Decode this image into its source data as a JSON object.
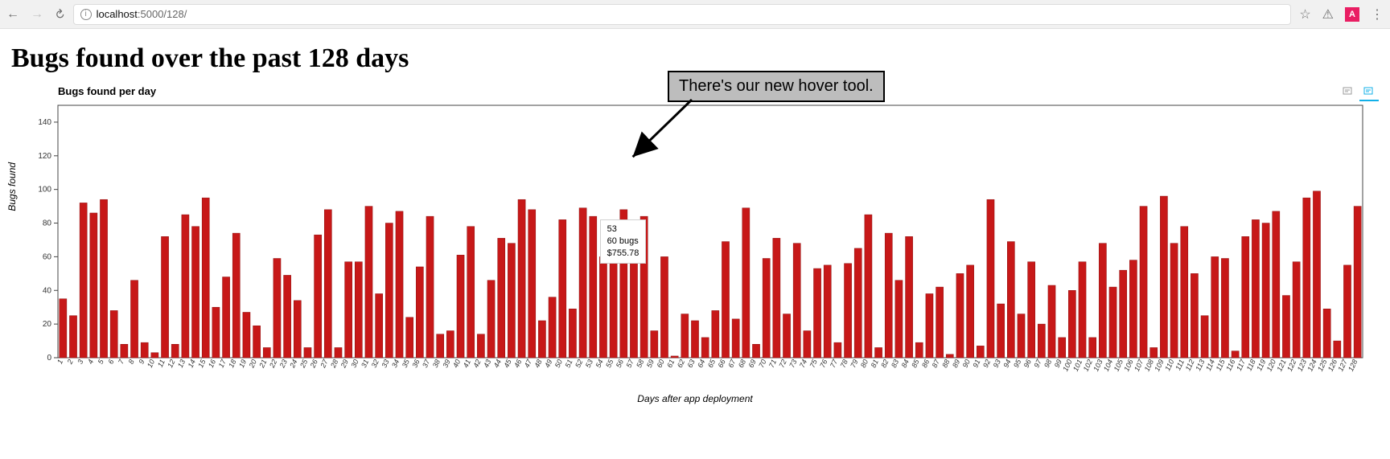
{
  "browser": {
    "url_prefix": "localhost",
    "url_rest": ":5000/128/",
    "badge_letter": "A"
  },
  "page_title": "Bugs found over the past 128 days",
  "annotation_text": "There's our new hover tool.",
  "tooltip": {
    "line1": "53",
    "line2": "60 bugs",
    "line3": "$755.78"
  },
  "chart_data": {
    "type": "bar",
    "title": "Bugs found per day",
    "xlabel": "Days after app deployment",
    "ylabel": "Bugs found",
    "ylim": [
      0,
      150
    ],
    "yticks": [
      0,
      20,
      40,
      60,
      80,
      100,
      120,
      140
    ],
    "categories": [
      1,
      2,
      3,
      4,
      5,
      6,
      7,
      8,
      9,
      10,
      11,
      12,
      13,
      14,
      15,
      16,
      17,
      18,
      19,
      20,
      21,
      22,
      23,
      24,
      25,
      26,
      27,
      28,
      29,
      30,
      31,
      32,
      33,
      34,
      35,
      36,
      37,
      38,
      39,
      40,
      41,
      42,
      43,
      44,
      45,
      46,
      47,
      48,
      49,
      50,
      51,
      52,
      53,
      54,
      55,
      56,
      57,
      58,
      59,
      60,
      61,
      62,
      63,
      64,
      65,
      66,
      67,
      68,
      69,
      70,
      71,
      72,
      73,
      74,
      75,
      76,
      77,
      78,
      79,
      80,
      81,
      82,
      83,
      84,
      85,
      86,
      87,
      88,
      89,
      90,
      91,
      92,
      93,
      94,
      95,
      96,
      97,
      98,
      99,
      100,
      101,
      102,
      103,
      104,
      105,
      106,
      107,
      108,
      109,
      110,
      111,
      112,
      113,
      114,
      115,
      116,
      117,
      118,
      119,
      120,
      121,
      122,
      123,
      124,
      125,
      126,
      127,
      128
    ],
    "values": [
      35,
      25,
      92,
      86,
      94,
      28,
      8,
      46,
      9,
      3,
      72,
      8,
      85,
      78,
      95,
      30,
      48,
      74,
      27,
      19,
      6,
      59,
      49,
      34,
      6,
      73,
      88,
      6,
      57,
      57,
      90,
      38,
      80,
      87,
      24,
      54,
      84,
      14,
      16,
      61,
      78,
      14,
      46,
      71,
      68,
      94,
      88,
      22,
      36,
      82,
      29,
      89,
      84,
      60,
      73,
      88,
      62,
      84,
      16,
      60,
      1,
      26,
      22,
      12,
      28,
      69,
      23,
      89,
      8,
      59,
      71,
      26,
      68,
      16,
      53,
      55,
      9,
      56,
      65,
      85,
      6,
      74,
      46,
      72,
      9,
      38,
      42,
      2,
      50,
      55,
      7,
      94,
      32,
      69,
      26,
      57,
      20,
      43,
      12,
      40,
      57,
      12,
      68,
      42,
      52,
      58,
      90,
      6,
      96,
      68,
      78,
      50,
      25,
      60,
      59,
      4,
      72,
      82,
      80,
      87,
      37,
      57,
      95,
      99,
      29,
      10,
      55,
      90
    ]
  }
}
